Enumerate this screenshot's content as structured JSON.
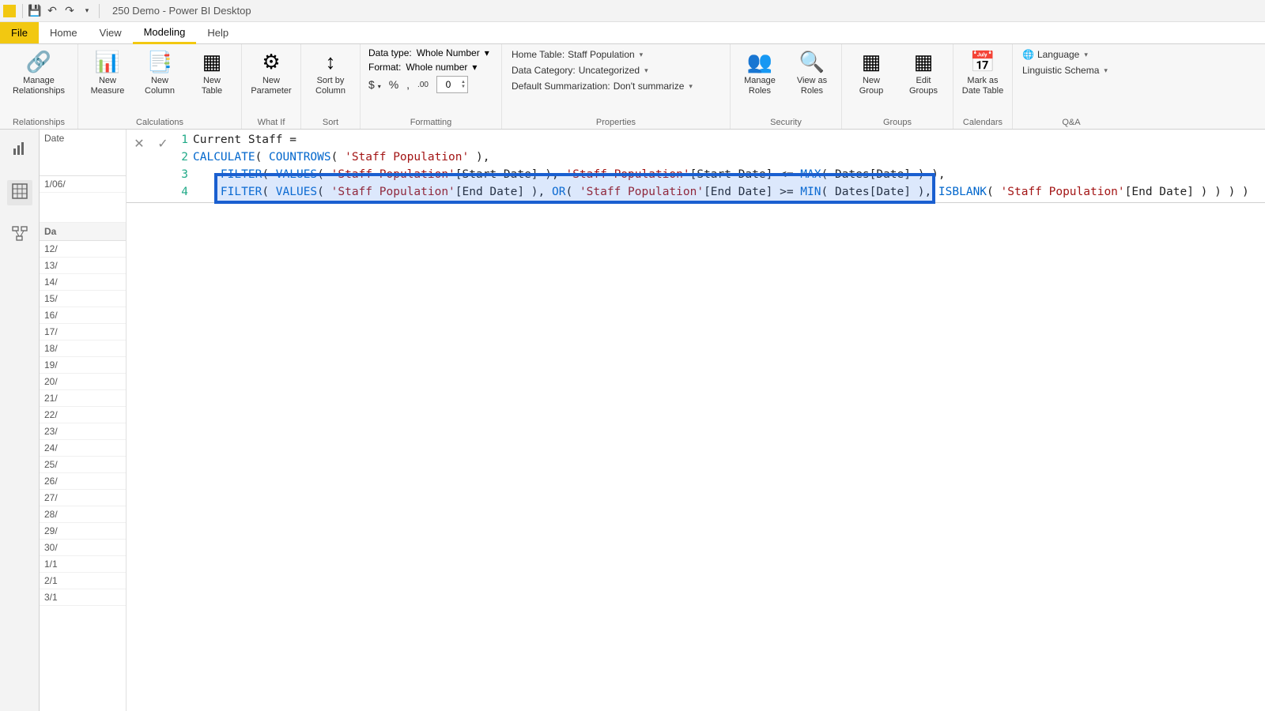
{
  "title": "250 Demo - Power BI Desktop",
  "tabs": {
    "file": "File",
    "home": "Home",
    "view": "View",
    "modeling": "Modeling",
    "help": "Help"
  },
  "ribbon": {
    "relationships": {
      "manage": "Manage\nRelationships",
      "group": "Relationships"
    },
    "calculations": {
      "measure": "New\nMeasure",
      "column": "New\nColumn",
      "table": "New\nTable",
      "group": "Calculations"
    },
    "whatif": {
      "param": "New\nParameter",
      "group": "What If"
    },
    "sort": {
      "sortby": "Sort by\nColumn",
      "group": "Sort"
    },
    "formatting": {
      "datatype_label": "Data type:",
      "datatype_value": "Whole Number",
      "format_label": "Format:",
      "format_value": "Whole number",
      "currency": "$",
      "percent": "%",
      "thousands": ",",
      "decimals_icon": ".00",
      "decimals_value": "0",
      "group": "Formatting"
    },
    "properties": {
      "hometable_label": "Home Table:",
      "hometable_value": "Staff Population",
      "datacat_label": "Data Category:",
      "datacat_value": "Uncategorized",
      "summ_label": "Default Summarization:",
      "summ_value": "Don't summarize",
      "group": "Properties"
    },
    "security": {
      "manage": "Manage\nRoles",
      "viewas": "View as\nRoles",
      "group": "Security"
    },
    "groups": {
      "new": "New\nGroup",
      "edit": "Edit\nGroups",
      "group": "Groups"
    },
    "calendars": {
      "mark": "Mark as\nDate Table",
      "group": "Calendars"
    },
    "qa": {
      "lang": "Language",
      "schema": "Linguistic Schema",
      "group": "Q&A"
    }
  },
  "grid": {
    "top_label": "Date",
    "top_value": "1/06/",
    "header": "Da",
    "rows": [
      "12/",
      "13/",
      "14/",
      "15/",
      "16/",
      "17/",
      "18/",
      "19/",
      "20/",
      "21/",
      "22/",
      "23/",
      "24/",
      "25/",
      "26/",
      "27/",
      "28/",
      "29/",
      "30/",
      "1/1",
      "2/1",
      "3/1"
    ]
  },
  "formula": {
    "line1": {
      "gutter": "1",
      "text": "Current Staff ="
    },
    "line2": {
      "gutter": "2",
      "segs": [
        {
          "t": "CALCULATE",
          "c": "kw-fn"
        },
        {
          "t": "( ",
          "c": "plain"
        },
        {
          "t": "COUNTROWS",
          "c": "kw-fn"
        },
        {
          "t": "( ",
          "c": "plain"
        },
        {
          "t": "'Staff Population'",
          "c": "kw-str"
        },
        {
          "t": " ),",
          "c": "plain"
        }
      ]
    },
    "line3": {
      "gutter": "3",
      "segs": [
        {
          "t": "    ",
          "c": "plain"
        },
        {
          "t": "FILTER",
          "c": "kw-fn"
        },
        {
          "t": "( ",
          "c": "plain"
        },
        {
          "t": "VALUES",
          "c": "kw-fn"
        },
        {
          "t": "( ",
          "c": "plain"
        },
        {
          "t": "'Staff Population'",
          "c": "kw-str"
        },
        {
          "t": "[Start Date] ), ",
          "c": "plain"
        },
        {
          "t": "'Staff Population'",
          "c": "kw-str"
        },
        {
          "t": "[Start Date] <= ",
          "c": "plain"
        },
        {
          "t": "MAX",
          "c": "kw-fn"
        },
        {
          "t": "( Dates[Date] ) ),",
          "c": "plain"
        }
      ]
    },
    "line4": {
      "gutter": "4",
      "segs": [
        {
          "t": "    ",
          "c": "plain"
        },
        {
          "t": "FILTER",
          "c": "kw-fn"
        },
        {
          "t": "( ",
          "c": "plain"
        },
        {
          "t": "VALUES",
          "c": "kw-fn"
        },
        {
          "t": "( ",
          "c": "plain"
        },
        {
          "t": "'Staff Population'",
          "c": "kw-str"
        },
        {
          "t": "[End Date] ), ",
          "c": "plain"
        },
        {
          "t": "OR",
          "c": "kw-fn"
        },
        {
          "t": "( ",
          "c": "plain"
        },
        {
          "t": "'Staff Population'",
          "c": "kw-str"
        },
        {
          "t": "[End Date] >= ",
          "c": "plain"
        },
        {
          "t": "MIN",
          "c": "kw-fn"
        },
        {
          "t": "( Dates[Date] ),",
          "c": "plain"
        },
        {
          "t": " ",
          "c": "plain"
        },
        {
          "t": "ISBLANK",
          "c": "kw-fn"
        },
        {
          "t": "( ",
          "c": "plain"
        },
        {
          "t": "'Staff Population'",
          "c": "kw-str"
        },
        {
          "t": "[End Date] ) ) ) )",
          "c": "plain"
        }
      ]
    }
  }
}
